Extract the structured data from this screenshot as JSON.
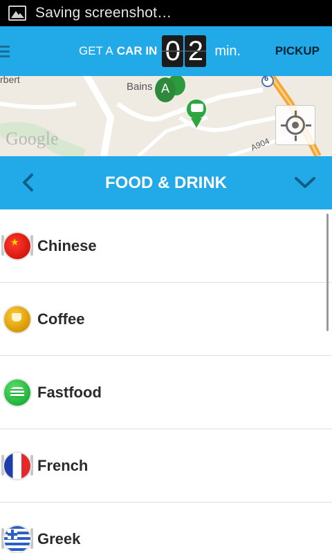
{
  "status_bar": {
    "text": "Saving screenshot…",
    "icon": "image-icon"
  },
  "app_bar": {
    "menu_icon": "hamburger-icon",
    "eta_prefix": "GET A",
    "eta_emphasis": "CAR IN",
    "eta_digits": [
      "0",
      "2"
    ],
    "eta_unit": "min.",
    "pickup_label": "PICKUP",
    "color": "#21a9e8"
  },
  "map": {
    "place_label": "Bains",
    "place_label_left": "rbert",
    "road_label": "A904",
    "road_number": "6",
    "google_label": "Google",
    "marker_label": "A",
    "locate_icon": "my-location-icon"
  },
  "category": {
    "title": "FOOD & DRINK",
    "back_icon": "chevron-left-icon",
    "expand_icon": "chevron-down-icon"
  },
  "list": {
    "items": [
      {
        "label": "Chinese",
        "icon": "china-flag-icon"
      },
      {
        "label": "Coffee",
        "icon": "coffee-icon"
      },
      {
        "label": "Fastfood",
        "icon": "burger-icon"
      },
      {
        "label": "French",
        "icon": "france-flag-icon"
      },
      {
        "label": "Greek",
        "icon": "greece-flag-icon"
      }
    ]
  }
}
